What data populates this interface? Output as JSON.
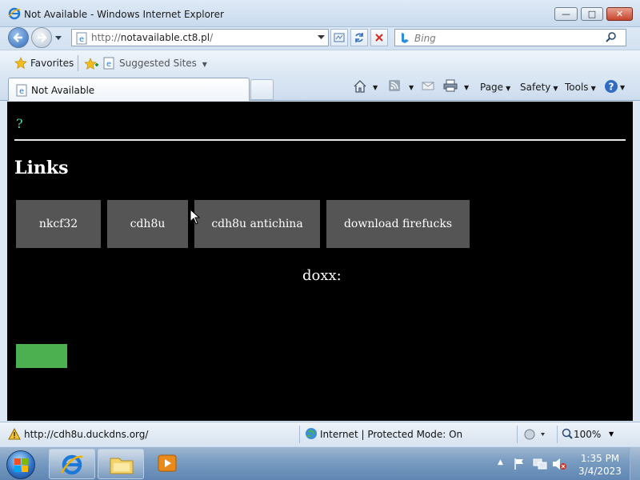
{
  "window": {
    "title": "Not Available - Windows Internet Explorer",
    "minimize": "—",
    "maximize": "□",
    "close": "✕"
  },
  "address": {
    "url_prefix": "http://",
    "url_domain": "notavailable.ct8.pl",
    "url_suffix": "/",
    "search_placeholder": "Bing"
  },
  "favorites_bar": {
    "favorites": "Favorites",
    "suggested": "Suggested Sites"
  },
  "tab": {
    "label": "Not Available"
  },
  "command_bar": {
    "page": "Page",
    "safety": "Safety",
    "tools": "Tools"
  },
  "page": {
    "symbol": "?",
    "heading": "Links",
    "buttons": [
      "nkcf32",
      "cdh8u",
      "cdh8u antichina",
      "download firefucks"
    ],
    "doxx": "doxx:"
  },
  "status_bar": {
    "link_url": "http://cdh8u.duckdns.org/",
    "zone": "Internet | Protected Mode: On",
    "zoom": "100%"
  },
  "taskbar": {
    "time": "1:35 PM",
    "date": "3/4/2023"
  },
  "colors": {
    "page_background": "#000000",
    "link_button": "#555555",
    "green_box": "#4caf50",
    "symbol": "#50e0a0"
  }
}
